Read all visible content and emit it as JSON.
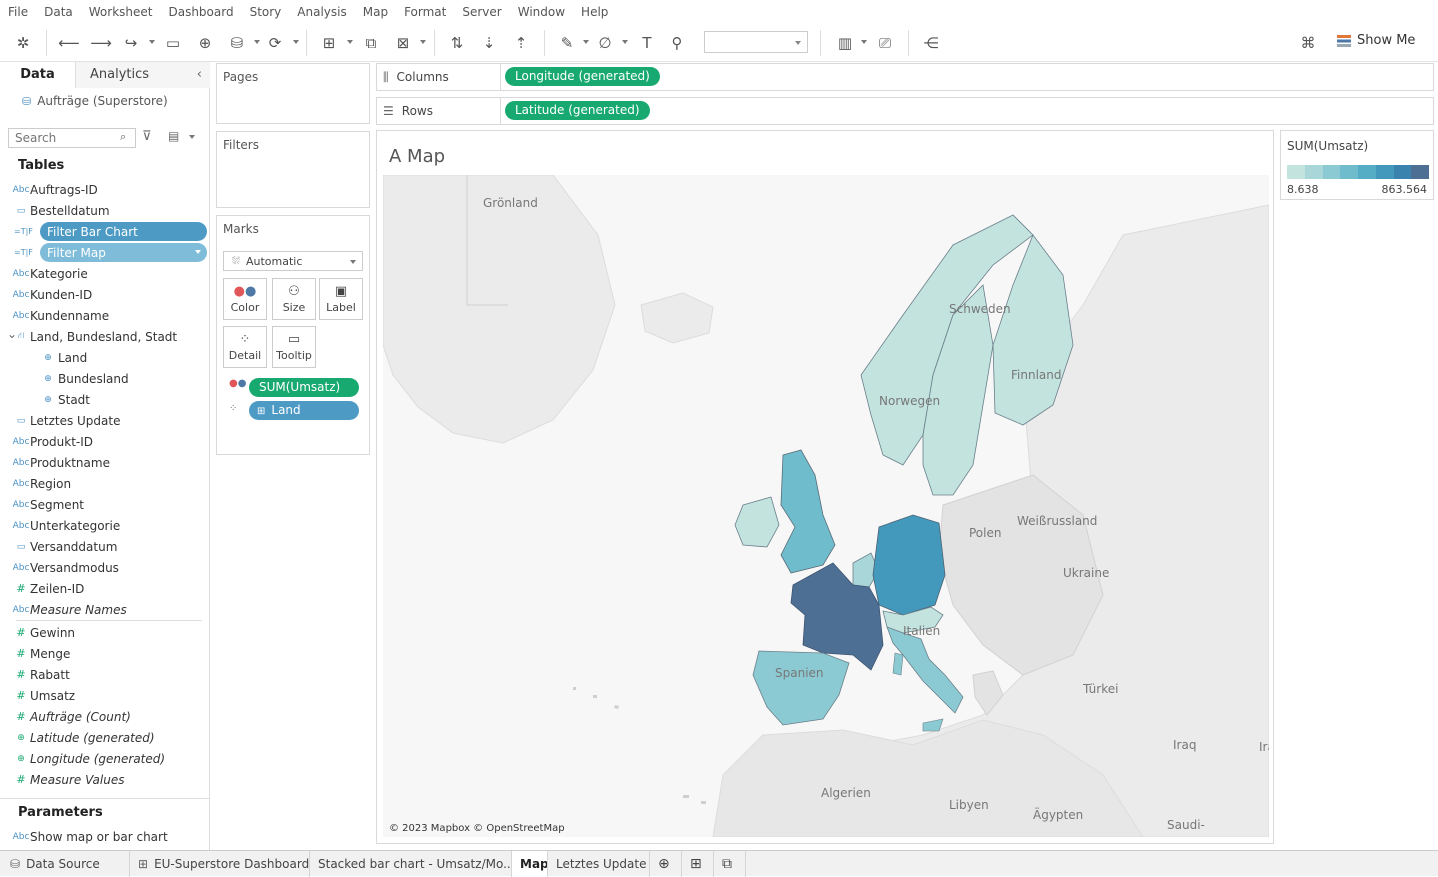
{
  "menu": [
    "File",
    "Data",
    "Worksheet",
    "Dashboard",
    "Story",
    "Analysis",
    "Map",
    "Format",
    "Server",
    "Window",
    "Help"
  ],
  "toolbar": {
    "show_me": "Show Me"
  },
  "data_pane": {
    "tabs": {
      "data": "Data",
      "analytics": "Analytics"
    },
    "datasource": "Aufträge (Superstore)",
    "search_placeholder": "Search",
    "tables_header": "Tables",
    "fields": [
      {
        "icon": "Abc",
        "label": "Auftrags-ID"
      },
      {
        "icon": "date",
        "label": "Bestelldatum"
      },
      {
        "icon": "=T|F",
        "label": "Filter Bar Chart",
        "pill": "dark"
      },
      {
        "icon": "=T|F",
        "label": "Filter Map",
        "pill": "light"
      },
      {
        "icon": "Abc",
        "label": "Kategorie"
      },
      {
        "icon": "Abc",
        "label": "Kunden-ID"
      },
      {
        "icon": "Abc",
        "label": "Kundenname"
      },
      {
        "icon": "hier",
        "label": "Land, Bundesland, Stadt"
      },
      {
        "icon": "geo",
        "label": "Land",
        "sub": true
      },
      {
        "icon": "geo",
        "label": "Bundesland",
        "sub": true
      },
      {
        "icon": "geo",
        "label": "Stadt",
        "sub": true
      },
      {
        "icon": "date",
        "label": "Letztes Update"
      },
      {
        "icon": "Abc",
        "label": "Produkt-ID"
      },
      {
        "icon": "Abc",
        "label": "Produktname"
      },
      {
        "icon": "Abc",
        "label": "Region"
      },
      {
        "icon": "Abc",
        "label": "Segment"
      },
      {
        "icon": "Abc",
        "label": "Unterkategorie"
      },
      {
        "icon": "date",
        "label": "Versanddatum"
      },
      {
        "icon": "Abc",
        "label": "Versandmodus"
      },
      {
        "icon": "#",
        "label": "Zeilen-ID"
      },
      {
        "icon": "Abc",
        "label": "Measure Names",
        "italic": true
      }
    ],
    "measures": [
      {
        "icon": "#",
        "label": "Gewinn"
      },
      {
        "icon": "#",
        "label": "Menge"
      },
      {
        "icon": "#",
        "label": "Rabatt"
      },
      {
        "icon": "#",
        "label": "Umsatz"
      },
      {
        "icon": "#",
        "label": "Aufträge (Count)",
        "italic": true
      },
      {
        "icon": "geo",
        "label": "Latitude (generated)",
        "italic": true
      },
      {
        "icon": "geo",
        "label": "Longitude (generated)",
        "italic": true
      },
      {
        "icon": "#",
        "label": "Measure Values",
        "italic": true
      }
    ],
    "parameters_header": "Parameters",
    "parameters": [
      {
        "icon": "Abc",
        "label": "Show map or bar chart"
      }
    ]
  },
  "cards": {
    "pages": "Pages",
    "filters": "Filters",
    "marks": "Marks",
    "mark_type": "Automatic",
    "buttons": {
      "color": "Color",
      "size": "Size",
      "label": "Label",
      "detail": "Detail",
      "tooltip": "Tooltip"
    },
    "mark_pills": [
      {
        "label": "SUM(Umsatz)",
        "kind": "color"
      },
      {
        "label": "Land",
        "kind": "detail"
      }
    ]
  },
  "shelves": {
    "columns_label": "Columns",
    "columns_pill": "Longitude (generated)",
    "rows_label": "Rows",
    "rows_pill": "Latitude (generated)"
  },
  "viz": {
    "title": "A Map",
    "attribution": "© 2023 Mapbox © OpenStreetMap",
    "place_labels": [
      "Grönland",
      "Schweden",
      "Finnland",
      "Norwegen",
      "Weißrussland",
      "Polen",
      "Ukraine",
      "Italien",
      "Spanien",
      "Türkei",
      "Iraq",
      "Ira",
      "Algerien",
      "Libyen",
      "Ägypten",
      "Saudi-"
    ],
    "legend": {
      "title": "SUM(Umsatz)",
      "min": "8.638",
      "max": "863.564",
      "colors": [
        "#c3e3df",
        "#a9d6d8",
        "#8ccad3",
        "#6fbccd",
        "#55acc5",
        "#4399bc",
        "#3a83ae",
        "#4e6f94"
      ]
    }
  },
  "sheet_tabs": {
    "data_source": "Data Source",
    "items": [
      "EU-Superstore Dashboard",
      "Stacked bar chart - Umsatz/Mo...",
      "Map",
      "Letztes Update"
    ],
    "active": "Map"
  }
}
